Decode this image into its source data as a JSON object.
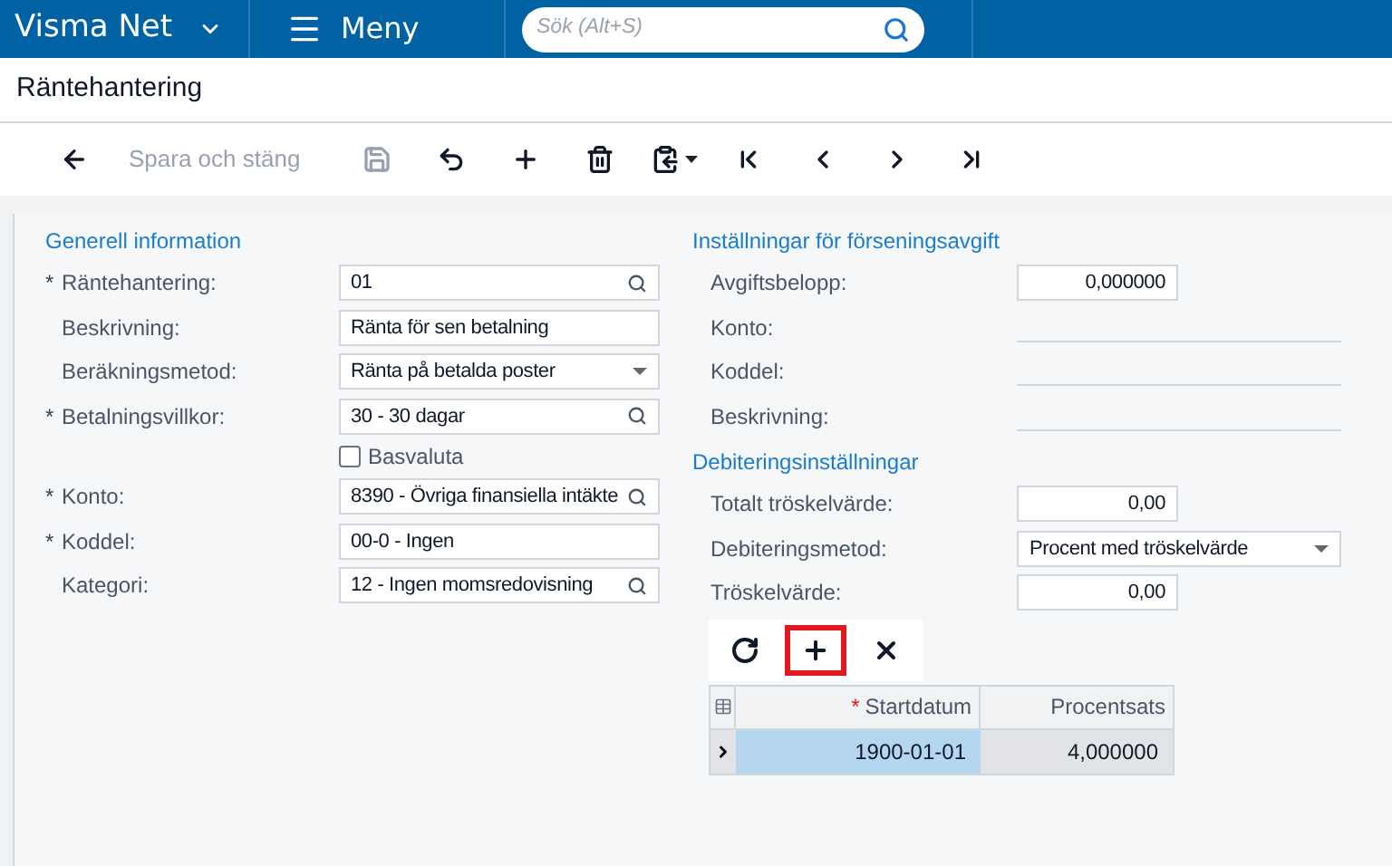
{
  "topbar": {
    "brand": "Visma Net",
    "menu": "Meny",
    "search": {
      "placeholder": "Sök (Alt+S)"
    }
  },
  "page_title": "Räntehantering",
  "toolbar": [
    {
      "kind": "back",
      "disabled": false
    },
    {
      "kind": "text",
      "label": "Spara och stäng",
      "disabled": true
    },
    {
      "kind": "save",
      "disabled": true
    },
    {
      "kind": "undo",
      "disabled": false
    },
    {
      "kind": "add",
      "disabled": false
    },
    {
      "kind": "delete",
      "disabled": false
    },
    {
      "kind": "copy",
      "disabled": false
    },
    {
      "kind": "first",
      "disabled": false
    },
    {
      "kind": "prev",
      "disabled": false
    },
    {
      "kind": "next",
      "disabled": false
    },
    {
      "kind": "last",
      "disabled": false
    }
  ],
  "general": {
    "title": "Generell information",
    "fields": [
      {
        "label": "Räntehantering:",
        "marker": "*",
        "kind": "lookup",
        "value": "01"
      },
      {
        "label": "Beskrivning:",
        "kind": "text",
        "value": "Ränta för sen betalning"
      },
      {
        "label": "Beräkningsmetod:",
        "kind": "select",
        "value": "Ränta på betalda poster"
      },
      {
        "label": "Betalningsvillkor:",
        "marker": "*",
        "kind": "lookup",
        "value": "30 - 30 dagar"
      },
      {
        "label": "Basvaluta",
        "kind": "checkbox",
        "checked": false
      },
      {
        "label": "Konto:",
        "marker": "*",
        "kind": "lookup",
        "value": "8390 - Övriga finansiella intäkte"
      },
      {
        "label": "Koddel:",
        "marker": "*",
        "kind": "text",
        "value": "00-0 - Ingen"
      },
      {
        "label": "Kategori:",
        "kind": "lookup",
        "value": "12 - Ingen momsredovisning"
      }
    ]
  },
  "late_fee": {
    "title": "Inställningar för förseningsavgift",
    "fields": [
      {
        "label": "Avgiftsbelopp:",
        "kind": "number",
        "value": "0,000000"
      },
      {
        "label": "Konto:",
        "kind": "empty"
      },
      {
        "label": "Koddel:",
        "kind": "empty"
      },
      {
        "label": "Beskrivning:",
        "kind": "empty"
      }
    ]
  },
  "debit": {
    "title": "Debiteringsinställningar",
    "fields": [
      {
        "label": "Totalt tröskelvärde:",
        "kind": "number",
        "value": "0,00"
      },
      {
        "label": "Debiteringsmetod:",
        "kind": "select",
        "value": "Procent med tröskelvärde"
      },
      {
        "label": "Tröskelvärde:",
        "kind": "number",
        "value": "0,00"
      }
    ]
  },
  "grid": {
    "toolbar": [
      {
        "kind": "refresh",
        "highlighted": false
      },
      {
        "kind": "add",
        "highlighted": true
      },
      {
        "kind": "delete",
        "highlighted": false
      }
    ],
    "columns": [
      {
        "label": "Startdatum",
        "marker": "*"
      },
      {
        "label": "Procentsats"
      }
    ],
    "rows": [
      {
        "selected": true,
        "cells": [
          "1900-01-01",
          "4,000000"
        ]
      }
    ]
  }
}
